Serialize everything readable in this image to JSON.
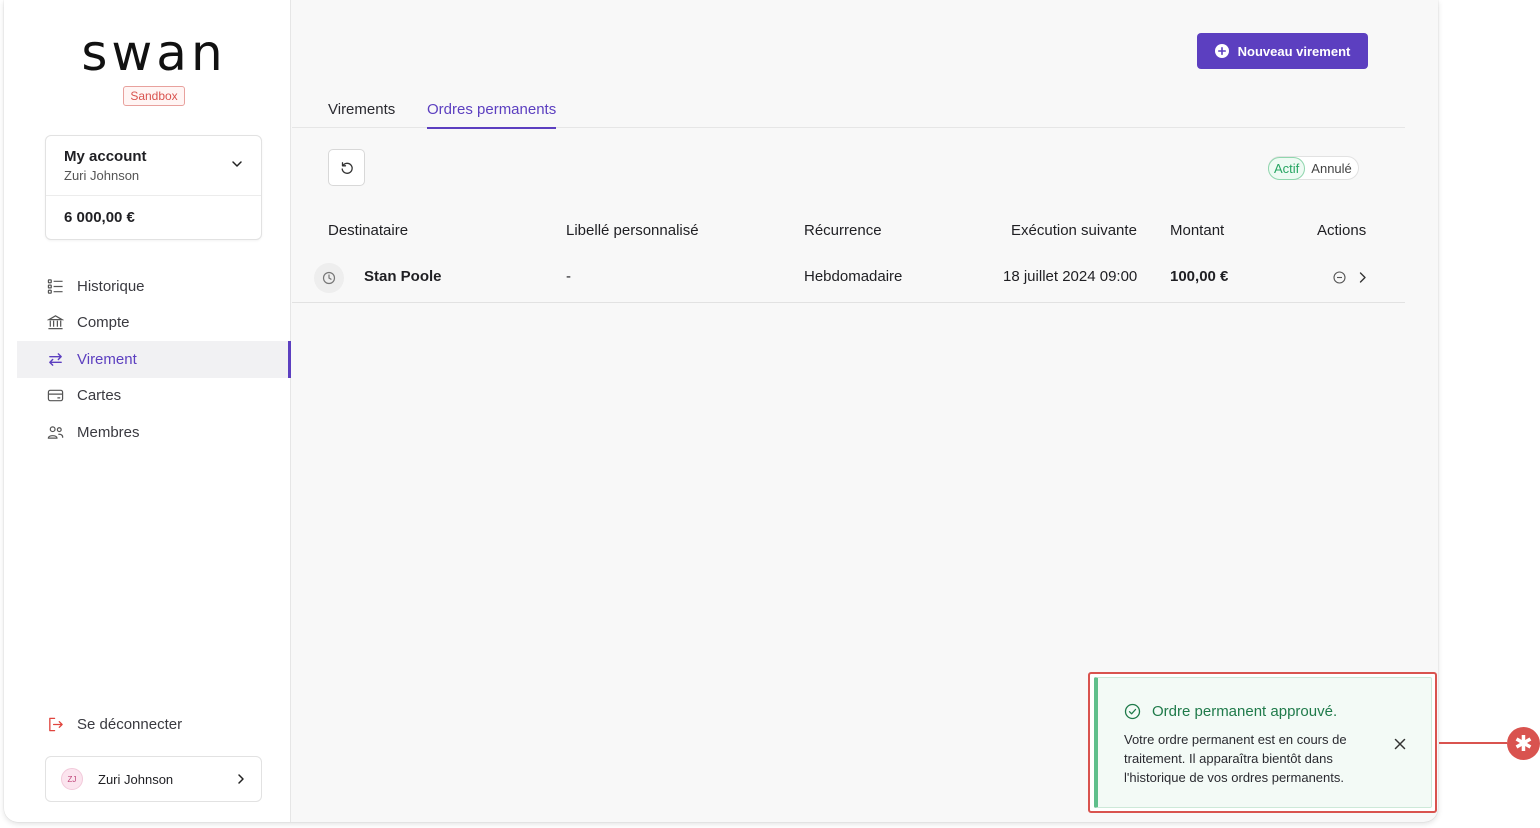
{
  "brand": {
    "logo_text": "swan",
    "env_badge": "Sandbox"
  },
  "account": {
    "name": "My account",
    "holder": "Zuri Johnson",
    "balance": "6 000,00 €"
  },
  "nav": {
    "items": [
      {
        "label": "Historique",
        "icon": "list-icon",
        "active": false
      },
      {
        "label": "Compte",
        "icon": "bank-icon",
        "active": false
      },
      {
        "label": "Virement",
        "icon": "transfer-arrows-icon",
        "active": true
      },
      {
        "label": "Cartes",
        "icon": "card-icon",
        "active": false
      },
      {
        "label": "Membres",
        "icon": "members-icon",
        "active": false
      }
    ],
    "logout_label": "Se déconnecter"
  },
  "user": {
    "initials": "ZJ",
    "name": "Zuri Johnson"
  },
  "header": {
    "new_button_label": "Nouveau virement"
  },
  "tabs": [
    {
      "label": "Virements",
      "active": false
    },
    {
      "label": "Ordres permanents",
      "active": true
    }
  ],
  "filters": {
    "active_label": "Actif",
    "cancelled_label": "Annulé"
  },
  "table": {
    "columns": [
      "Destinataire",
      "Libellé personnalisé",
      "Récurrence",
      "Exécution suivante",
      "Montant",
      "Actions"
    ],
    "rows": [
      {
        "recipient": "Stan Poole",
        "label": "-",
        "recurrence": "Hebdomadaire",
        "next_execution": "18 juillet 2024 09:00",
        "amount": "100,00 €"
      }
    ]
  },
  "toast": {
    "title": "Ordre permanent approuvé.",
    "message": "Votre ordre permanent est en cours de traitement. Il apparaîtra bientôt dans l'historique de vos ordres permanents."
  },
  "annotation": {
    "marker": "✱"
  },
  "colors": {
    "accent": "#5c3fc0",
    "success": "#27a562",
    "highlight": "#d9534f"
  }
}
